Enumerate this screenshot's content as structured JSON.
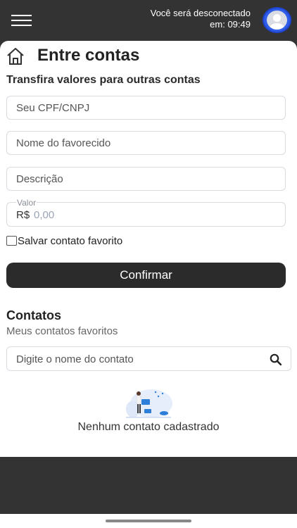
{
  "header": {
    "session_line1": "Você será desconectado",
    "session_line2": "em: 09:49",
    "menu_icon": "hamburger-menu-icon",
    "avatar_icon": "user-avatar-icon"
  },
  "page": {
    "title": "Entre contas",
    "subtitle": "Transfira valores para outras contas",
    "home_icon": "home-icon"
  },
  "form": {
    "cpf_placeholder": "Seu CPF/CNPJ",
    "name_placeholder": "Nome do favorecido",
    "description_placeholder": "Descrição",
    "value_label": "Valor",
    "currency": "R$",
    "value_placeholder": "0,00",
    "save_favorite_label": "Salvar contato favorito",
    "save_favorite_checked": false,
    "confirm_label": "Confirmar"
  },
  "contacts": {
    "title": "Contatos",
    "subtitle": "Meus contatos favoritos",
    "search_placeholder": "Digite o nome do contato",
    "search_icon": "search-icon",
    "empty_message": "Nenhum contato cadastrado"
  },
  "colors": {
    "header_bg": "#333333",
    "button_bg": "#2b2b2b",
    "avatar_ring": "#2f5ce8",
    "illustration_blue": "#2e7fd9"
  }
}
